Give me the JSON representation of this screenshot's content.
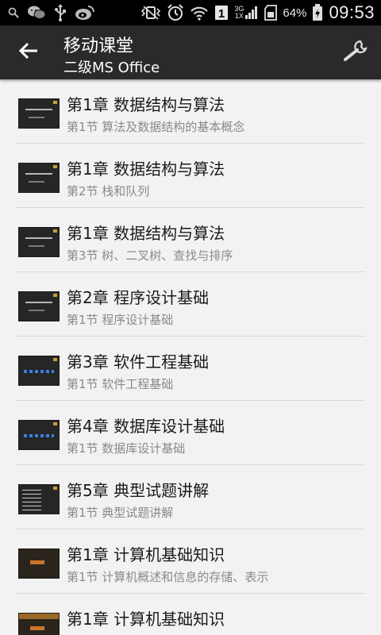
{
  "status_bar": {
    "left_icons": [
      "search-icon",
      "wechat-icon",
      "usb-icon",
      "weibo-icon"
    ],
    "right_icons": [
      "vibrate-icon",
      "alarm-icon",
      "wifi-icon",
      "sim-1-icon",
      "signal-icon",
      "sd-card-icon",
      "battery-icon"
    ],
    "sim_label": "1",
    "network_top": "3G",
    "network_bottom": "1X",
    "battery": "64%",
    "time": "09:53"
  },
  "toolbar": {
    "title": "移动课堂",
    "subtitle": "二级MS Office",
    "back_icon": "back-arrow-icon",
    "settings_icon": "wrench-icon"
  },
  "lessons": [
    {
      "title": "第1章 数据结构与算法",
      "subtitle": "第1节 算法及数据结构的基本概念"
    },
    {
      "title": "第1章 数据结构与算法",
      "subtitle": "第2节 栈和队列"
    },
    {
      "title": "第1章 数据结构与算法",
      "subtitle": "第3节 树、二叉树、查找与排序"
    },
    {
      "title": "第2章 程序设计基础",
      "subtitle": "第1节 程序设计基础"
    },
    {
      "title": "第3章 软件工程基础",
      "subtitle": "第1节 软件工程基础"
    },
    {
      "title": "第4章 数据库设计基础",
      "subtitle": "第1节 数据库设计基础"
    },
    {
      "title": "第5章 典型试题讲解",
      "subtitle": "第1节 典型试题讲解"
    },
    {
      "title": "第1章 计算机基础知识",
      "subtitle": "第1节 计算机概述和信息的存储、表示"
    },
    {
      "title": "第1章 计算机基础知识",
      "subtitle": ""
    }
  ]
}
